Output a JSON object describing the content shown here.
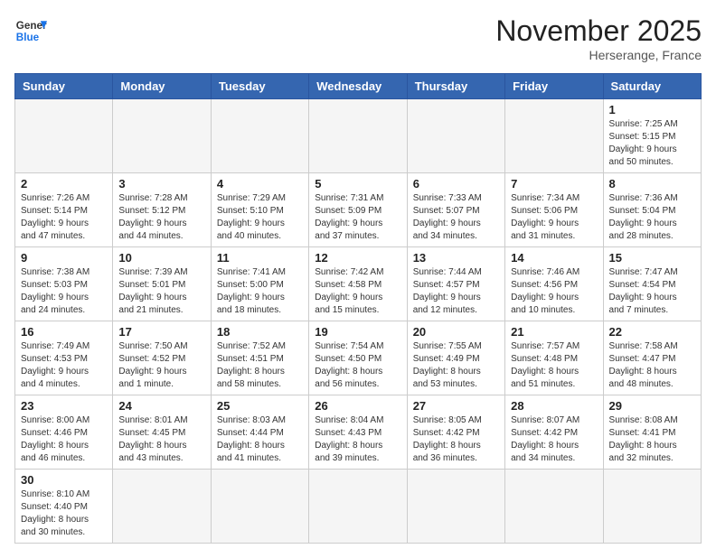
{
  "header": {
    "logo_general": "General",
    "logo_blue": "Blue",
    "month_title": "November 2025",
    "subtitle": "Herserange, France"
  },
  "weekdays": [
    "Sunday",
    "Monday",
    "Tuesday",
    "Wednesday",
    "Thursday",
    "Friday",
    "Saturday"
  ],
  "weeks": [
    [
      {
        "day": "",
        "info": ""
      },
      {
        "day": "",
        "info": ""
      },
      {
        "day": "",
        "info": ""
      },
      {
        "day": "",
        "info": ""
      },
      {
        "day": "",
        "info": ""
      },
      {
        "day": "",
        "info": ""
      },
      {
        "day": "1",
        "info": "Sunrise: 7:25 AM\nSunset: 5:15 PM\nDaylight: 9 hours\nand 50 minutes."
      }
    ],
    [
      {
        "day": "2",
        "info": "Sunrise: 7:26 AM\nSunset: 5:14 PM\nDaylight: 9 hours\nand 47 minutes."
      },
      {
        "day": "3",
        "info": "Sunrise: 7:28 AM\nSunset: 5:12 PM\nDaylight: 9 hours\nand 44 minutes."
      },
      {
        "day": "4",
        "info": "Sunrise: 7:29 AM\nSunset: 5:10 PM\nDaylight: 9 hours\nand 40 minutes."
      },
      {
        "day": "5",
        "info": "Sunrise: 7:31 AM\nSunset: 5:09 PM\nDaylight: 9 hours\nand 37 minutes."
      },
      {
        "day": "6",
        "info": "Sunrise: 7:33 AM\nSunset: 5:07 PM\nDaylight: 9 hours\nand 34 minutes."
      },
      {
        "day": "7",
        "info": "Sunrise: 7:34 AM\nSunset: 5:06 PM\nDaylight: 9 hours\nand 31 minutes."
      },
      {
        "day": "8",
        "info": "Sunrise: 7:36 AM\nSunset: 5:04 PM\nDaylight: 9 hours\nand 28 minutes."
      }
    ],
    [
      {
        "day": "9",
        "info": "Sunrise: 7:38 AM\nSunset: 5:03 PM\nDaylight: 9 hours\nand 24 minutes."
      },
      {
        "day": "10",
        "info": "Sunrise: 7:39 AM\nSunset: 5:01 PM\nDaylight: 9 hours\nand 21 minutes."
      },
      {
        "day": "11",
        "info": "Sunrise: 7:41 AM\nSunset: 5:00 PM\nDaylight: 9 hours\nand 18 minutes."
      },
      {
        "day": "12",
        "info": "Sunrise: 7:42 AM\nSunset: 4:58 PM\nDaylight: 9 hours\nand 15 minutes."
      },
      {
        "day": "13",
        "info": "Sunrise: 7:44 AM\nSunset: 4:57 PM\nDaylight: 9 hours\nand 12 minutes."
      },
      {
        "day": "14",
        "info": "Sunrise: 7:46 AM\nSunset: 4:56 PM\nDaylight: 9 hours\nand 10 minutes."
      },
      {
        "day": "15",
        "info": "Sunrise: 7:47 AM\nSunset: 4:54 PM\nDaylight: 9 hours\nand 7 minutes."
      }
    ],
    [
      {
        "day": "16",
        "info": "Sunrise: 7:49 AM\nSunset: 4:53 PM\nDaylight: 9 hours\nand 4 minutes."
      },
      {
        "day": "17",
        "info": "Sunrise: 7:50 AM\nSunset: 4:52 PM\nDaylight: 9 hours\nand 1 minute."
      },
      {
        "day": "18",
        "info": "Sunrise: 7:52 AM\nSunset: 4:51 PM\nDaylight: 8 hours\nand 58 minutes."
      },
      {
        "day": "19",
        "info": "Sunrise: 7:54 AM\nSunset: 4:50 PM\nDaylight: 8 hours\nand 56 minutes."
      },
      {
        "day": "20",
        "info": "Sunrise: 7:55 AM\nSunset: 4:49 PM\nDaylight: 8 hours\nand 53 minutes."
      },
      {
        "day": "21",
        "info": "Sunrise: 7:57 AM\nSunset: 4:48 PM\nDaylight: 8 hours\nand 51 minutes."
      },
      {
        "day": "22",
        "info": "Sunrise: 7:58 AM\nSunset: 4:47 PM\nDaylight: 8 hours\nand 48 minutes."
      }
    ],
    [
      {
        "day": "23",
        "info": "Sunrise: 8:00 AM\nSunset: 4:46 PM\nDaylight: 8 hours\nand 46 minutes."
      },
      {
        "day": "24",
        "info": "Sunrise: 8:01 AM\nSunset: 4:45 PM\nDaylight: 8 hours\nand 43 minutes."
      },
      {
        "day": "25",
        "info": "Sunrise: 8:03 AM\nSunset: 4:44 PM\nDaylight: 8 hours\nand 41 minutes."
      },
      {
        "day": "26",
        "info": "Sunrise: 8:04 AM\nSunset: 4:43 PM\nDaylight: 8 hours\nand 39 minutes."
      },
      {
        "day": "27",
        "info": "Sunrise: 8:05 AM\nSunset: 4:42 PM\nDaylight: 8 hours\nand 36 minutes."
      },
      {
        "day": "28",
        "info": "Sunrise: 8:07 AM\nSunset: 4:42 PM\nDaylight: 8 hours\nand 34 minutes."
      },
      {
        "day": "29",
        "info": "Sunrise: 8:08 AM\nSunset: 4:41 PM\nDaylight: 8 hours\nand 32 minutes."
      }
    ],
    [
      {
        "day": "30",
        "info": "Sunrise: 8:10 AM\nSunset: 4:40 PM\nDaylight: 8 hours\nand 30 minutes."
      },
      {
        "day": "",
        "info": ""
      },
      {
        "day": "",
        "info": ""
      },
      {
        "day": "",
        "info": ""
      },
      {
        "day": "",
        "info": ""
      },
      {
        "day": "",
        "info": ""
      },
      {
        "day": "",
        "info": ""
      }
    ]
  ]
}
